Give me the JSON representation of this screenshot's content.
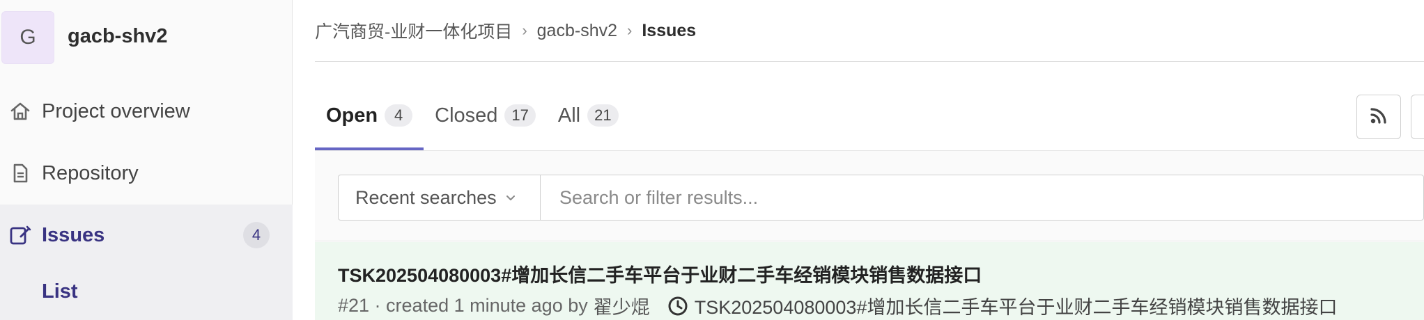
{
  "project": {
    "avatar_letter": "G",
    "name": "gacb-shv2"
  },
  "sidebar": {
    "items": [
      {
        "label": "Project overview",
        "icon": "home-icon"
      },
      {
        "label": "Repository",
        "icon": "document-icon"
      },
      {
        "label": "Issues",
        "icon": "issues-icon",
        "count": "4",
        "active": true
      }
    ],
    "sub_items": [
      {
        "label": "List",
        "active": true
      }
    ]
  },
  "breadcrumb": {
    "items": [
      "广汽商贸-业财一体化项目",
      "gacb-shv2"
    ],
    "current": "Issues"
  },
  "tabs": [
    {
      "label": "Open",
      "count": "4",
      "active": true
    },
    {
      "label": "Closed",
      "count": "17"
    },
    {
      "label": "All",
      "count": "21"
    }
  ],
  "filter": {
    "recent_label": "Recent searches",
    "search_placeholder": "Search or filter results..."
  },
  "issues": [
    {
      "title": "TSK202504080003#增加长信二手车平台于业财二手车经销模块销售数据接口",
      "meta": "#21 · created 1 minute ago by",
      "author": "翟少焜",
      "milestone": "TSK202504080003#增加长信二手车平台于业财二手车经销模块销售数据接口"
    }
  ],
  "colors": {
    "accent": "#393382",
    "tab_underline": "#6666c4",
    "issue_row_bg": "#eef8f0"
  }
}
